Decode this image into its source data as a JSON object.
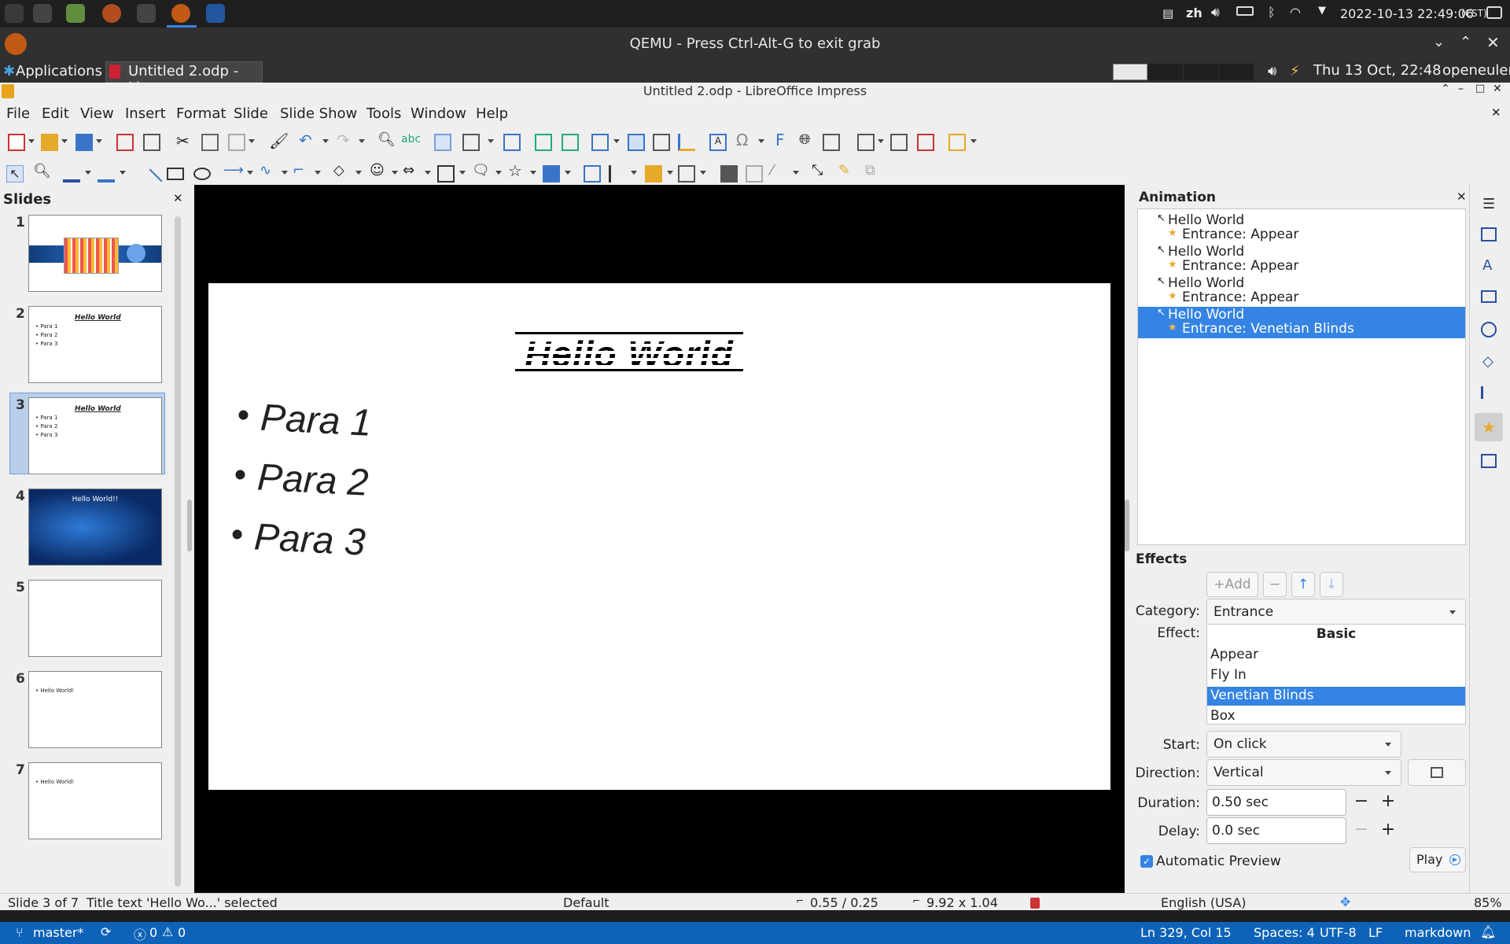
{
  "host": {
    "input_method": "zh",
    "datetime": "2022-10-13  22:49:06",
    "timezone": "(CST)"
  },
  "qemu": {
    "title": "QEMU - Press Ctrl-Alt-G to exit grab"
  },
  "guest_panel": {
    "applications": "Applications",
    "task": "Untitled 2.odp - Li...",
    "clock": "Thu 13 Oct, 22:48",
    "user": "openeuler"
  },
  "window": {
    "title": "Untitled 2.odp - LibreOffice Impress"
  },
  "menu": [
    "File",
    "Edit",
    "View",
    "Insert",
    "Format",
    "Slide",
    "Slide Show",
    "Tools",
    "Window",
    "Help"
  ],
  "slides_panel": {
    "title": "Slides",
    "numbers": [
      "1",
      "2",
      "3",
      "4",
      "5",
      "6",
      "7"
    ],
    "thumb_title": "Hello World",
    "thumb_paras": [
      "Para 1",
      "Para 2",
      "Para 3"
    ],
    "thumb4_title": "Hello World!!",
    "thumb_hello": "Hello World!"
  },
  "slide": {
    "title": "Hello World",
    "paras": [
      "Para 1",
      "Para 2",
      "Para 3"
    ]
  },
  "animation": {
    "title": "Animation",
    "items": [
      {
        "name": "Hello World",
        "effect": "Entrance: Appear"
      },
      {
        "name": "Hello World",
        "effect": "Entrance: Appear"
      },
      {
        "name": "Hello World",
        "effect": "Entrance: Appear"
      },
      {
        "name": "Hello World",
        "effect": "Entrance: Venetian Blinds"
      }
    ]
  },
  "effects": {
    "title": "Effects",
    "add": "Add",
    "remove": "−",
    "category_label": "Category:",
    "category": "Entrance",
    "effect_label": "Effect:",
    "list_header": "Basic",
    "list": [
      "Appear",
      "Fly In",
      "Venetian Blinds",
      "Box"
    ],
    "selected": "Venetian Blinds",
    "start_label": "Start:",
    "start": "On click",
    "direction_label": "Direction:",
    "direction": "Vertical",
    "duration_label": "Duration:",
    "duration": "0.50 sec",
    "delay_label": "Delay:",
    "delay": "0.0 sec",
    "auto_preview": "Automatic Preview",
    "play": "Play"
  },
  "status": {
    "slide": "Slide 3 of 7",
    "selection": "Title text 'Hello Wo...' selected",
    "master": "Default",
    "position": "0.55 / 0.25",
    "size": "9.92 x 1.04",
    "language": "English (USA)",
    "zoom": "85%"
  },
  "vscode": {
    "branch": "master*",
    "problems": "0",
    "warnings": "0",
    "cursor": "Ln 329, Col 15",
    "spaces": "Spaces: 4",
    "encoding": "UTF-8",
    "eol": "LF",
    "language": "markdown"
  },
  "colors": {
    "accent": "#3584e4",
    "vscode": "#0e63b8"
  }
}
